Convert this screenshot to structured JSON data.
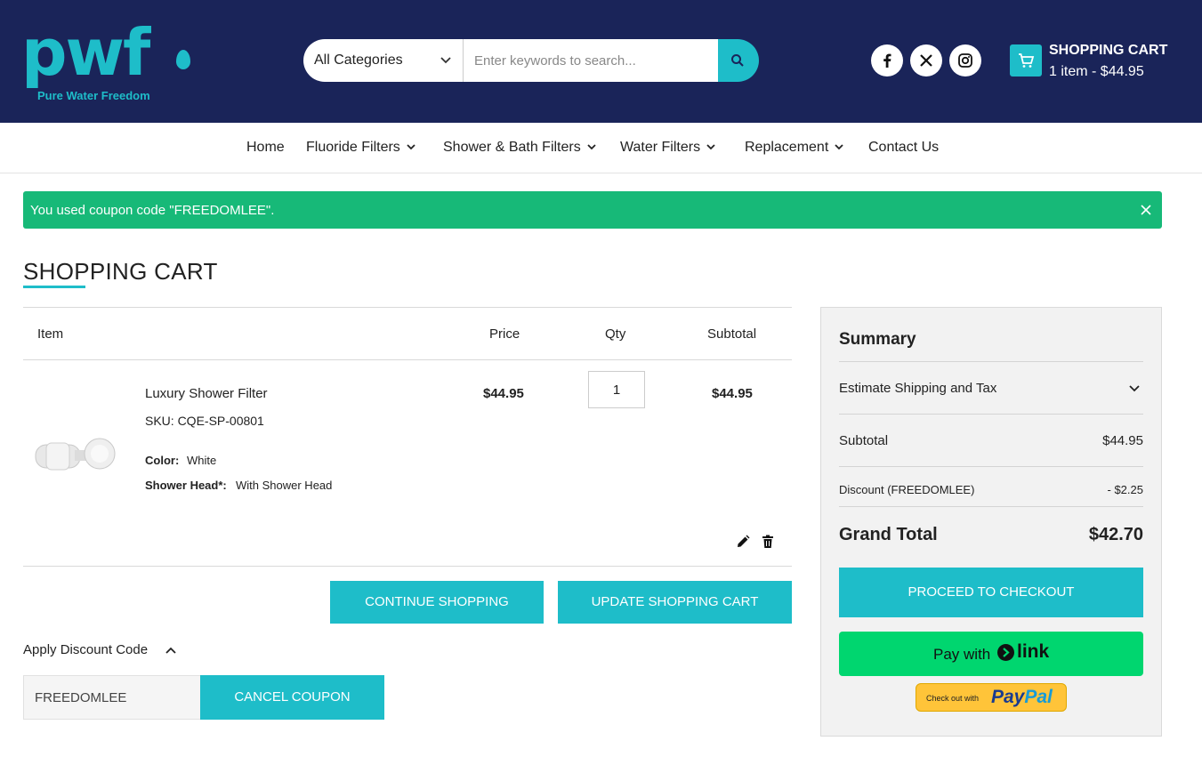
{
  "header": {
    "logo_text": "pwf",
    "logo_subtitle": "Pure Water Freedom",
    "category_selected": "All Categories",
    "search_placeholder": "Enter keywords to search...",
    "cart_title": "SHOPPING CART",
    "cart_summary": "1 item - $44.95"
  },
  "nav": {
    "home": "Home",
    "fluoride": "Fluoride Filters",
    "shower": "Shower & Bath Filters",
    "water": "Water Filters",
    "replacement": "Replacement",
    "contact": "Contact Us"
  },
  "alert": {
    "message": "You used coupon code \"FREEDOMLEE\"."
  },
  "page": {
    "title": "SHOPPING CART"
  },
  "table": {
    "headers": {
      "item": "Item",
      "price": "Price",
      "qty": "Qty",
      "subtotal": "Subtotal"
    },
    "rows": [
      {
        "name": "Luxury Shower Filter",
        "sku": "SKU: CQE-SP-00801",
        "options": [
          {
            "label": "Color:",
            "value": "White"
          },
          {
            "label": "Shower Head*:",
            "value": "With Shower Head"
          }
        ],
        "price": "$44.95",
        "qty": "1",
        "subtotal": "$44.95"
      }
    ]
  },
  "actions": {
    "continue": "CONTINUE SHOPPING",
    "update": "UPDATE SHOPPING CART"
  },
  "discount": {
    "title": "Apply Discount Code",
    "code_value": "FREEDOMLEE",
    "cancel": "CANCEL COUPON"
  },
  "summary": {
    "title": "Summary",
    "estimate": "Estimate Shipping and Tax",
    "subtotal_label": "Subtotal",
    "subtotal_value": "$44.95",
    "discount_label": "Discount (FREEDOMLEE)",
    "discount_value": "- $2.25",
    "grand_label": "Grand Total",
    "grand_value": "$42.70",
    "checkout": "PROCEED TO CHECKOUT",
    "link_pay": "Pay with",
    "link_word": "link",
    "paypal_small": "Check out with",
    "paypal_1": "Pay",
    "paypal_2": "Pal"
  },
  "colors": {
    "header_bg": "#1a2459",
    "accent": "#1ebdc9",
    "alert": "#17b978",
    "link_green": "#00d66f",
    "paypal_gold": "#ffc439"
  }
}
